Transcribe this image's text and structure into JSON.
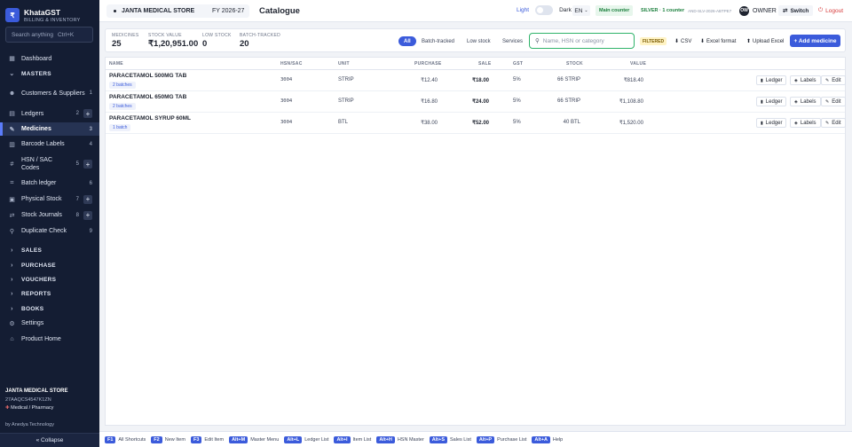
{
  "brand": {
    "logo": "₹",
    "name": "KhataGST",
    "subtitle": "BILLING & INVENTORY"
  },
  "sidebar": {
    "search_placeholder": "Search anything",
    "search_shortcut": "Ctrl+K",
    "items": [
      {
        "label": "Dashboard",
        "icon": "▦",
        "count": ""
      },
      {
        "label": "MASTERS",
        "icon": "⌄",
        "count": ""
      },
      {
        "label": "Customers & Suppliers",
        "icon": "☻",
        "count": "1"
      },
      {
        "label": "Ledgers",
        "icon": "▤",
        "count": "2"
      },
      {
        "label": "Medicines",
        "icon": "✎",
        "count": "3"
      },
      {
        "label": "Barcode Labels",
        "icon": "▥",
        "count": "4"
      },
      {
        "label": "HSN / SAC Codes",
        "icon": "#",
        "count": "5"
      },
      {
        "label": "Batch ledger",
        "icon": "⌗",
        "count": "6"
      },
      {
        "label": "Physical Stock",
        "icon": "▣",
        "count": "7"
      },
      {
        "label": "Stock Journals",
        "icon": "⇄",
        "count": "8"
      },
      {
        "label": "Duplicate Check",
        "icon": "⚲",
        "count": "9"
      },
      {
        "label": "SALES",
        "icon": "›",
        "count": ""
      },
      {
        "label": "PURCHASE",
        "icon": "›",
        "count": ""
      },
      {
        "label": "VOUCHERS",
        "icon": "›",
        "count": ""
      },
      {
        "label": "REPORTS",
        "icon": "›",
        "count": ""
      },
      {
        "label": "BOOKS",
        "icon": "›",
        "count": ""
      },
      {
        "label": "Settings",
        "icon": "⚙",
        "count": ""
      },
      {
        "label": "Product Home",
        "icon": "⌂",
        "count": ""
      }
    ],
    "store_name": "JANTA MEDICAL STORE",
    "store_gstin": "27AAQCS4547K1ZN",
    "store_type": "Medical / Pharmacy",
    "byline": "by Anedya Technology",
    "collapse_label": "« Collapse"
  },
  "topbar": {
    "store": "JANTA MEDICAL STORE",
    "fy": "FY 2026-27",
    "title": "Catalogue",
    "theme_light": "Light",
    "theme_dark": "Dark",
    "lang": "EN",
    "counter": "Main counter",
    "licence": "SILVER · 1 counter",
    "licence_code": "AND-SLV-2026-ABTPE7",
    "owner_initials": "OW",
    "owner_label": "OWNER",
    "switch_label": "Switch",
    "logout_label": "Logout"
  },
  "stats": [
    {
      "label": "MEDICINES",
      "value": "25"
    },
    {
      "label": "STOCK VALUE",
      "value": "₹1,20,951.00"
    },
    {
      "label": "LOW STOCK",
      "value": "0"
    },
    {
      "label": "BATCH-TRACKED",
      "value": "20"
    }
  ],
  "filters": [
    "All",
    "Batch-tracked",
    "Low stock",
    "Services"
  ],
  "search": {
    "placeholder": "Name, HSN or category"
  },
  "filtered_badge": "FILTERED",
  "actions": {
    "csv": "CSV",
    "excel": "Excel format",
    "upload": "Upload Excel",
    "add": "+ Add medicine"
  },
  "table": {
    "headers": [
      "NAME",
      "HSN/SAC",
      "UNIT",
      "PURCHASE",
      "SALE",
      "GST",
      "STOCK",
      "VALUE"
    ],
    "rows": [
      {
        "name": "PARACETAMOL 500MG TAB",
        "batches": "2 batches",
        "hsn": "3004",
        "unit": "STRIP",
        "purchase": "₹12.40",
        "sale": "₹18.00",
        "gst": "5%",
        "stock": "66 STRIP",
        "value": "₹818.40"
      },
      {
        "name": "PARACETAMOL 650MG TAB",
        "batches": "2 batches",
        "hsn": "3004",
        "unit": "STRIP",
        "purchase": "₹16.80",
        "sale": "₹24.00",
        "gst": "5%",
        "stock": "66 STRIP",
        "value": "₹1,108.80"
      },
      {
        "name": "PARACETAMOL SYRUP 60ML",
        "batches": "1 batch",
        "hsn": "3004",
        "unit": "BTL",
        "purchase": "₹38.00",
        "sale": "₹52.00",
        "gst": "5%",
        "stock": "40 BTL",
        "value": "₹1,520.00"
      }
    ],
    "row_actions": [
      "Ledger",
      "Labels",
      "Edit"
    ]
  },
  "shortcuts": [
    {
      "key": "F1",
      "label": "All Shortcuts"
    },
    {
      "key": "F2",
      "label": "New Item"
    },
    {
      "key": "F3",
      "label": "Edit Item"
    },
    {
      "key": "Alt+M",
      "label": "Master Menu"
    },
    {
      "key": "Alt+L",
      "label": "Ledger List"
    },
    {
      "key": "Alt+I",
      "label": "Item List"
    },
    {
      "key": "Alt+H",
      "label": "HSN Master"
    },
    {
      "key": "Alt+S",
      "label": "Sales List"
    },
    {
      "key": "Alt+P",
      "label": "Purchase List"
    },
    {
      "key": "Alt+A",
      "label": "Help"
    }
  ]
}
